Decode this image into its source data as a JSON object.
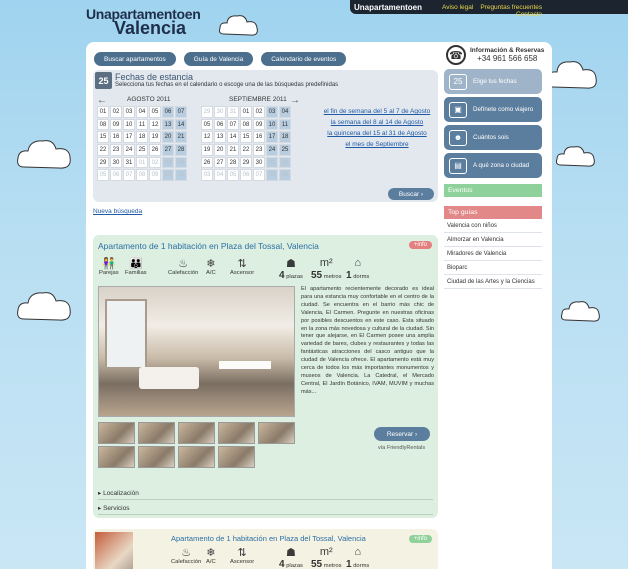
{
  "logo": {
    "line1": "Unapartamentoen",
    "line2": "Valencia"
  },
  "topbar": {
    "brand": "Unapartamentoen",
    "links": [
      "Aviso legal",
      "Preguntas frecuentes"
    ],
    "contact": "Contacto"
  },
  "nav": [
    "Buscar apartamentos",
    "Guía de Valencia",
    "Calendario de eventos"
  ],
  "phone": {
    "title": "Información & Reservas",
    "number": "+34 961 566 658"
  },
  "calendar": {
    "icon": "25",
    "title": "Fechas de estancia",
    "subtitle": "Selecciona tus fechas en el calendario o escoge una de las búsquedas predefinidas",
    "month1": "AGOSTO 2011",
    "month2": "SEPTIEMBRE 2011",
    "weekend_links": [
      "el fin de semana del 5 al 7 de Agosto",
      "la semana del 8 al 14 de Agosto",
      "la quincena del 15 al 31 de Agosto",
      "el mes de Septiembre"
    ],
    "search_button": "Buscar"
  },
  "new_search": "Nueva búsqueda",
  "sidebar": {
    "buttons": [
      "Elige tus fechas",
      "Defínete como viajero",
      "Cuántos sois",
      "A qué zona o ciudad"
    ],
    "events": "Eventos",
    "top_guides": "Top guías",
    "guides": [
      "Valencia con niños",
      "Almorzar en Valencia",
      "Miradores de Valencia",
      "Bioparc",
      "Ciudad de las Artes y la Ciencias"
    ]
  },
  "listing": {
    "title": "Apartamento de 1 habitación en Plaza del Tossal, Valencia",
    "info": "+info",
    "amenities": [
      "Parejas",
      "Familias",
      "Calefacción",
      "A/C",
      "Ascensor"
    ],
    "stats": {
      "plazas_num": "4",
      "plazas": "plazas",
      "metros_num": "55",
      "metros": "metros",
      "dorms_num": "1",
      "dorms": "dorms"
    },
    "description": "El apartamento recientemente decorado es ideal para una estancia muy confortable en el centro de la ciudad. Se encuentra en el barrio más chic de Valencia, El Carmen. Pregunte en nuestras oficinas por posibles descuentos en este caso. Esta situado en la zona más novedosa y cultural de la ciudad. Sin tener que alejarse, en El Carmen posee una amplia variedad de bares, clubes y restaurantes y todas las fantásticas atracciones del casco antiguo que la ciudad de Valencia ofrece. El apartamento está muy cerca de todos los más importantes monumentos y museos de Valencia. La Catedral, el Mercado Central, El Jardín Botánico, IVAM, MUVIM y muchas más...",
    "reserve": "Reservar",
    "via": "vía FriendlyRentals",
    "sections": [
      "Localización",
      "Servicios"
    ]
  },
  "listing2": {
    "title": "Apartamento de 1 habitación en Plaza del Tossal, Valencia",
    "info": "+info",
    "amenities": [
      "Calefacción",
      "A/C",
      "Ascensor"
    ],
    "stats": {
      "plazas_num": "4",
      "plazas": "plazas",
      "metros_num": "55",
      "metros": "metros",
      "dorms_num": "1",
      "dorms": "dorms"
    }
  }
}
